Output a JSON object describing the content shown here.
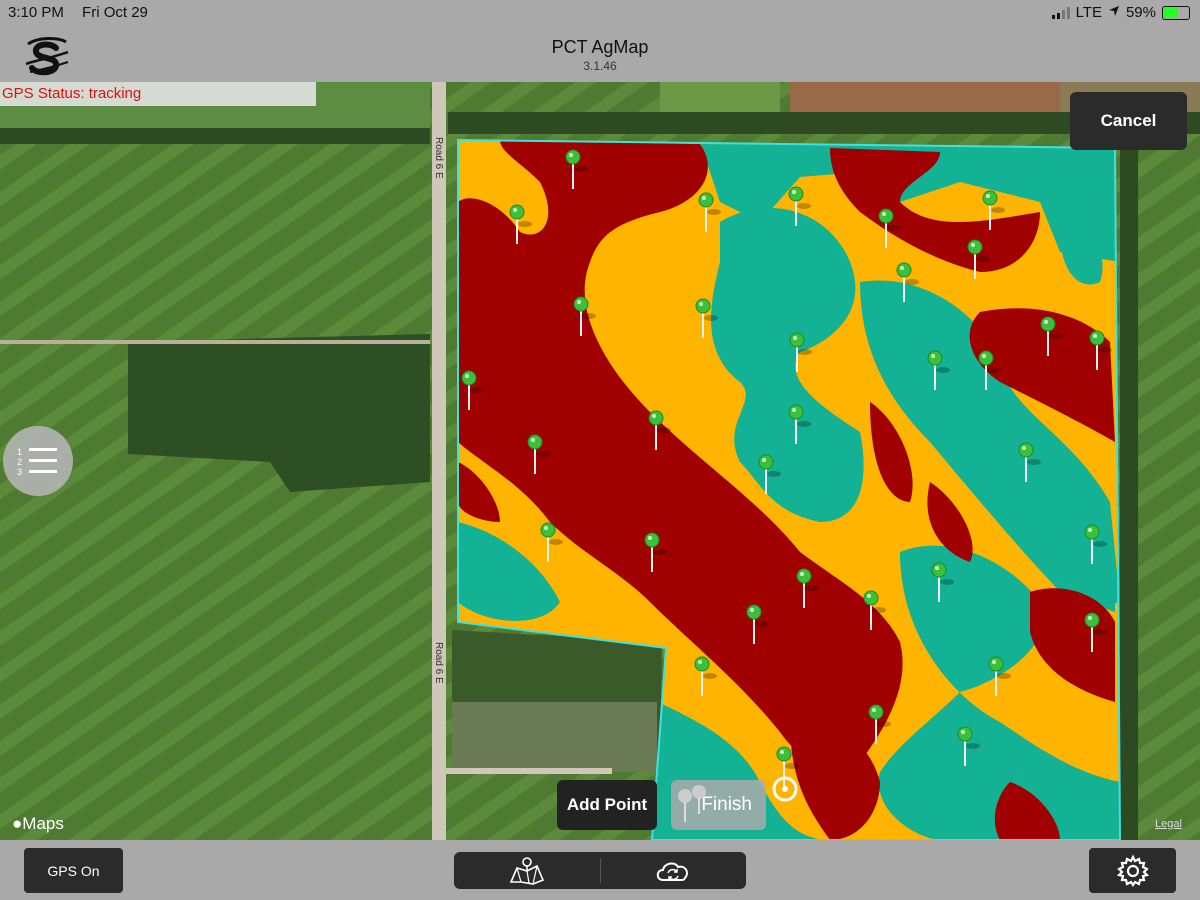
{
  "status_bar": {
    "time": "3:10 PM",
    "date": "Fri Oct 29",
    "network": "LTE",
    "battery": "59%",
    "battery_level": 0.59,
    "icons": [
      "signal-bars-icon",
      "location-arrow-icon",
      "battery-charging-icon"
    ]
  },
  "header": {
    "title": "PCT AgMap",
    "version": "3.1.46",
    "logo_icon": "pct-logo-icon"
  },
  "map": {
    "gps_status": "GPS Status: tracking",
    "cancel_label": "Cancel",
    "add_point_label": "Add Point",
    "finish_label": "Finish",
    "maps_attribution": "Maps",
    "legal_label": "Legal",
    "road_label": "Road 6 E",
    "zone_colors": {
      "low": "#a00000",
      "medium": "#ffb400",
      "high": "#14b294",
      "boundary": "#40e0e0",
      "pin": "#3cc03c"
    },
    "list_button_icon": "numbered-list-icon"
  },
  "bottom_bar": {
    "gps_on_label": "GPS On",
    "map_button_icon": "field-map-icon",
    "sync_button_icon": "cloud-sync-icon",
    "settings_icon": "gear-icon"
  }
}
